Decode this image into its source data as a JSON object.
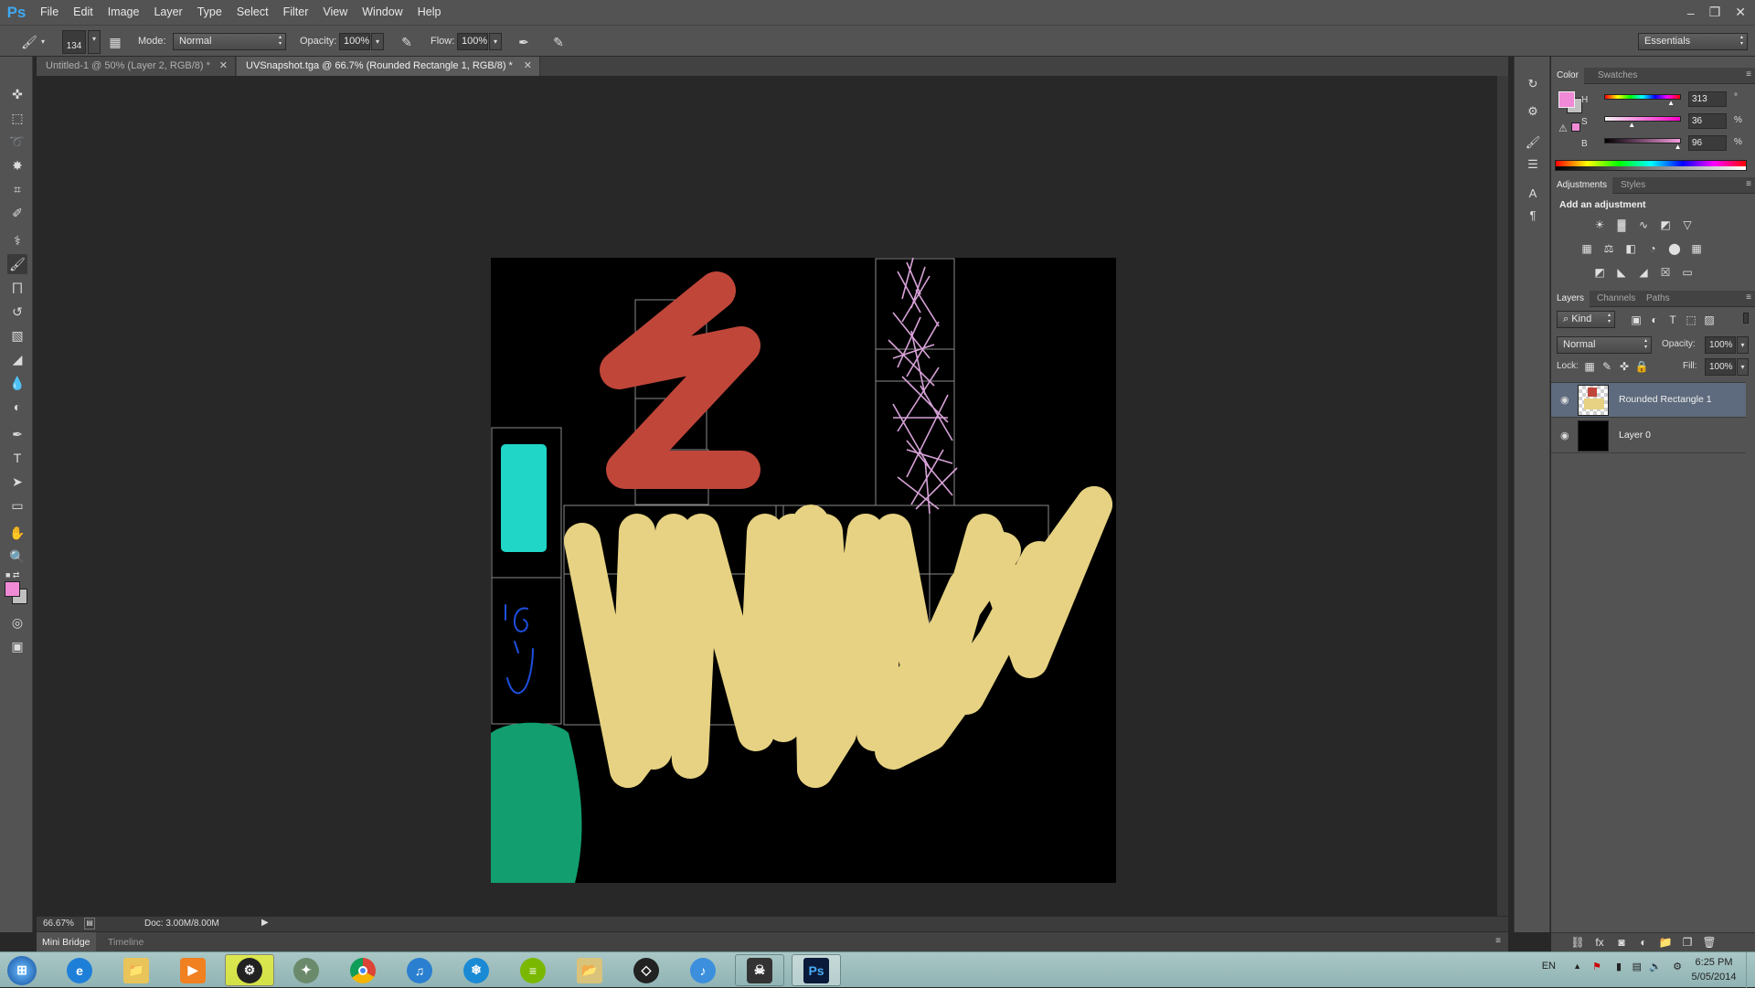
{
  "app": {
    "logo": "Ps"
  },
  "menu": [
    "File",
    "Edit",
    "Image",
    "Layer",
    "Type",
    "Select",
    "Filter",
    "View",
    "Window",
    "Help"
  ],
  "window_controls": {
    "minimize": "–",
    "restore": "❐",
    "close": "✕"
  },
  "options_bar": {
    "brush_size": "134",
    "mode_label": "Mode:",
    "mode_value": "Normal",
    "opacity_label": "Opacity:",
    "opacity_value": "100%",
    "flow_label": "Flow:",
    "flow_value": "100%",
    "workspace": "Essentials"
  },
  "tabs": [
    {
      "label": "Untitled-1 @ 50% (Layer 2, RGB/8) *",
      "active": false
    },
    {
      "label": "UVSnapshot.tga @ 66.7% (Rounded Rectangle 1, RGB/8) *",
      "active": true
    }
  ],
  "status": {
    "zoom": "66.67%",
    "doc": "Doc: 3.00M/8.00M"
  },
  "bottom_tabs": [
    "Mini Bridge",
    "Timeline"
  ],
  "color_panel": {
    "tabs": [
      "Color",
      "Swatches"
    ],
    "foreground": "#f08ad6",
    "background": "#c0c0c0",
    "H": {
      "label": "H",
      "value": "313",
      "unit": "°",
      "level": 0.87
    },
    "S": {
      "label": "S",
      "value": "36",
      "unit": "%",
      "level": 0.36
    },
    "B": {
      "label": "B",
      "value": "96",
      "unit": "%",
      "level": 0.96
    }
  },
  "adjustments_panel": {
    "tabs": [
      "Adjustments",
      "Styles"
    ],
    "heading": "Add an adjustment"
  },
  "layers_panel": {
    "tabs": [
      "Layers",
      "Channels",
      "Paths"
    ],
    "filter_kind": "Kind",
    "blend_mode": "Normal",
    "opacity_label": "Opacity:",
    "opacity_value": "100%",
    "lock_label": "Lock:",
    "fill_label": "Fill:",
    "fill_value": "100%",
    "layers": [
      {
        "name": "Rounded Rectangle 1",
        "selected": true
      },
      {
        "name": "Layer 0",
        "selected": false
      }
    ]
  },
  "tray": {
    "lang": "EN",
    "time": "6:25 PM",
    "date": "5/05/2014"
  },
  "colors": {
    "red_stroke": "#c0463a",
    "yellow_stroke": "#e6d282",
    "cyan_rect": "#1fd6c7",
    "green_shape": "#129e6f",
    "blue_doodle": "#1e4fe0",
    "pink_fur": "#d7a2d8"
  }
}
